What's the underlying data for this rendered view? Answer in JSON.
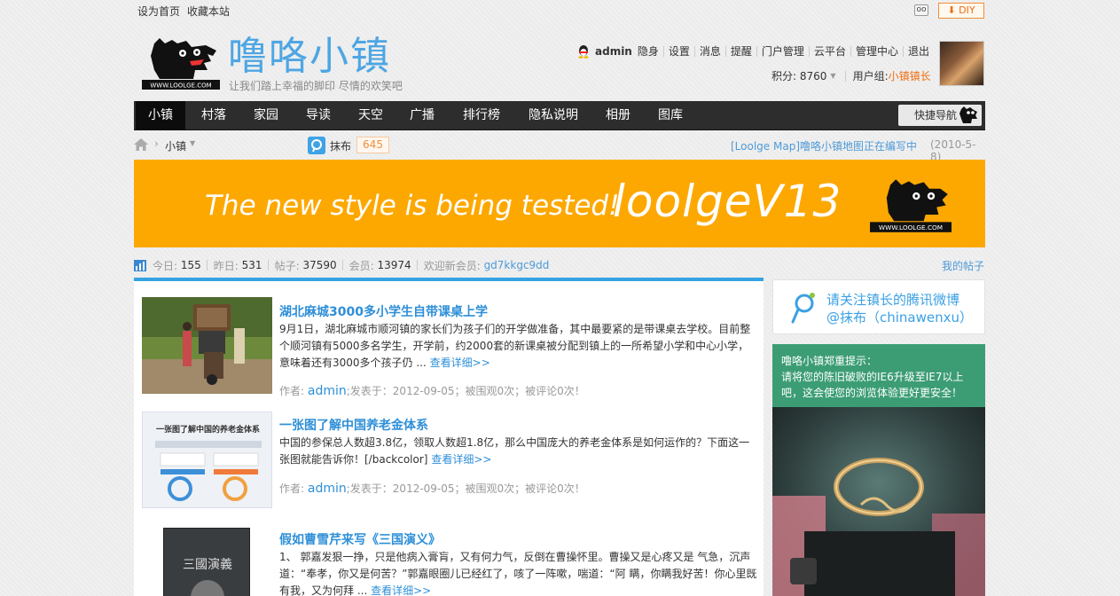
{
  "topbar": {
    "set_home": "设为首页",
    "bookmark": "收藏本站",
    "diy_label": "DIY",
    "diy_arrow": "⬇"
  },
  "header": {
    "site_title": "噜咯小镇",
    "slogan": "让我们踏上幸福的脚印 尽情的欢笑吧",
    "logo_text": "WWW.LOOLGE.COM"
  },
  "user": {
    "username": "admin",
    "links": [
      "隐身",
      "设置",
      "消息",
      "提醒",
      "门户管理",
      "云平台",
      "管理中心",
      "退出"
    ],
    "credits_label": "积分: 8760",
    "group_label": "用户组: ",
    "group_value": "小镇镇长"
  },
  "nav": {
    "items": [
      "小镇",
      "村落",
      "家园",
      "导读",
      "天空",
      "广播",
      "排行榜",
      "隐私说明",
      "相册",
      "图库"
    ],
    "active_index": 0,
    "quick_nav": "快捷导航"
  },
  "breadcrumb": {
    "current": "小镇",
    "weibo_name": "抹布",
    "weibo_count": "645",
    "announcement": "[Loolge Map]噜咯小镇地图正在编写中",
    "announcement_date": "(2010-5-8)"
  },
  "banner": {
    "tagline": "The new style is being tested!",
    "version": "loolgeV13",
    "logo_text": "WWW.LOOLGE.COM"
  },
  "stats": {
    "today_label": "今日:",
    "today_value": "155",
    "yesterday_label": "昨日:",
    "yesterday_value": "531",
    "posts_label": "帖子:",
    "posts_value": "37590",
    "members_label": "会员:",
    "members_value": "13974",
    "welcome_label": "欢迎新会员:",
    "new_member": "gd7kkgc9dd",
    "my_threads": "我的帖子"
  },
  "articles": [
    {
      "title": "湖北麻城3000多小学生自带课桌上学",
      "desc": "9月1日，湖北麻城市顺河镇的家长们为孩子们的开学做准备，其中最要紧的是带课桌去学校。目前整个顺河镇有5000多名学生，开学前，约2000套的新课桌被分配到镇上的一所希望小学和中心小学，意味着还有3000多个孩子仍 ...",
      "more": "查看详细>>",
      "meta_prefix": "作者:",
      "author": "admin",
      "meta_suffix": ";发表于：2012-09-05；被围观0次；被评论0次！"
    },
    {
      "title": "一张图了解中国养老金体系",
      "desc": "中国的参保总人数超3.8亿，领取人数超1.8亿，那么中国庞大的养老金体系是如何运作的？下面这一张图就能告诉你！[/backcolor]",
      "more": "查看详细>>",
      "meta_prefix": "作者:",
      "author": "admin",
      "meta_suffix": ";发表于：2012-09-05；被围观0次；被评论0次！",
      "thumb_title": "一张图了解中国的养老金体系"
    },
    {
      "title": "假如曹雪芹来写《三国演义》",
      "desc": "1、 郭嘉发狠一挣，只是他病入膏肓，又有何力气，反倒在曹操怀里。曹操又是心疼又是 气急，沉声道：“奉孝，你又是何苦？”郭嘉眼圈儿已经红了，咳了一阵嗽，喘道：“阿 瞒，你瞒我好苦！你心里既有我，又为何拜 ...",
      "more": "查看详细>>",
      "thumb_title": "三國演義"
    }
  ],
  "sidebar": {
    "weibo_line1": "请关注镇长的腾讯微博",
    "weibo_line2": "@抹布（chinawenxu）",
    "notice_title": "噜咯小镇郑重提示：",
    "notice_body": "请将您的陈旧破败的IE6升级至IE7以上吧，这会使您的浏览体验更好更安全！"
  }
}
